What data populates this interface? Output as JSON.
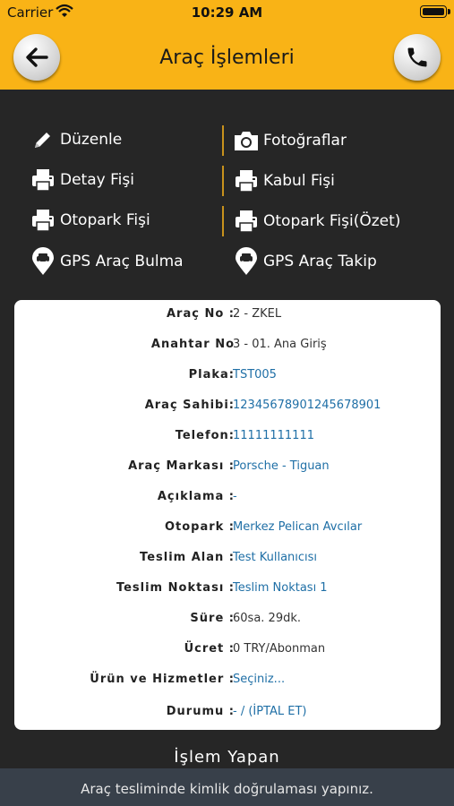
{
  "status_bar": {
    "carrier": "Carrier",
    "time": "10:29 AM"
  },
  "header": {
    "title": "Araç İşlemleri",
    "back_icon": "arrow-left",
    "call_icon": "phone"
  },
  "actions": [
    {
      "label": "Düzenle",
      "icon": "pencil-icon"
    },
    {
      "label": "Fotoğraflar",
      "icon": "camera-icon"
    },
    {
      "label": "Detay Fişi",
      "icon": "printer-icon"
    },
    {
      "label": "Kabul Fişi",
      "icon": "printer-icon"
    },
    {
      "label": "Otopark Fişi",
      "icon": "printer-icon"
    },
    {
      "label": "Otopark Fişi(Özet)",
      "icon": "printer-icon"
    },
    {
      "label": "GPS Araç Bulma",
      "icon": "map-pin-car-icon"
    },
    {
      "label": "GPS Araç Takip",
      "icon": "map-pin-car-icon"
    }
  ],
  "details": [
    {
      "label": "Araç No :",
      "value": "2 - ZKEL",
      "link": false
    },
    {
      "label": "Anahtar No",
      "value": "3 - 01. Ana Giriş",
      "link": false
    },
    {
      "label": "Plaka:",
      "value": "TST005",
      "link": true
    },
    {
      "label": "Araç Sahibi:",
      "value": "12345678901245678901",
      "link": true
    },
    {
      "label": "Telefon:",
      "value": "11111111111",
      "link": true
    },
    {
      "label": "Araç Markası :",
      "value": "Porsche - Tiguan",
      "link": true
    },
    {
      "label": "Açıklama :",
      "value": "-",
      "link": true
    },
    {
      "label": "Otopark :",
      "value": "Merkez Pelican Avcılar",
      "link": true
    },
    {
      "label": "Teslim Alan :",
      "value": "Test Kullanıcısı",
      "link": true
    },
    {
      "label": "Teslim Noktası :",
      "value": "Teslim Noktası 1",
      "link": true
    },
    {
      "label": "Süre :",
      "value": "60sa. 29dk.",
      "link": false
    },
    {
      "label": "Ücret :",
      "value": "0 TRY/Abonman",
      "link": false
    },
    {
      "label": "Ürün ve Hizmetler :",
      "value": "Seçiniz...",
      "link": true
    },
    {
      "label": "Durumu :",
      "value": "- / (İPTAL ET)",
      "link": true
    }
  ],
  "section_title": "İşlem Yapan",
  "footer": {
    "message": "Araç tesliminde kimlik doğrulaması yapınız."
  },
  "colors": {
    "accent": "#f9b316",
    "background": "#262626",
    "link": "#1f6fa6",
    "footer": "#38404a",
    "separator": "#c8921c"
  }
}
